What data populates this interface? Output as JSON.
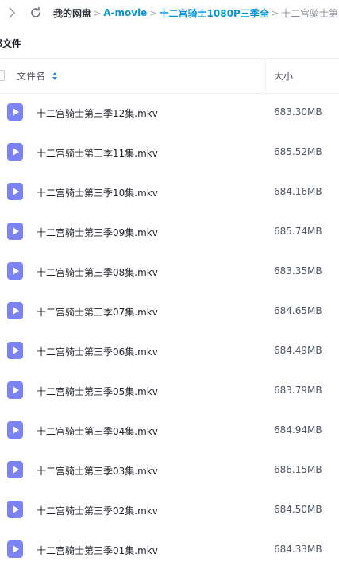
{
  "breadcrumb": {
    "root": "我的网盘",
    "items": [
      "A-movie",
      "十二宫骑士1080P三季全"
    ],
    "current": "十二宫骑士第三季"
  },
  "section_title": "部文件",
  "table": {
    "col_name": "文件名",
    "col_size": "大小"
  },
  "files": [
    {
      "name": "十二宫骑士第三季12集.mkv",
      "size": "683.30MB"
    },
    {
      "name": "十二宫骑士第三季11集.mkv",
      "size": "685.52MB"
    },
    {
      "name": "十二宫骑士第三季10集.mkv",
      "size": "684.16MB"
    },
    {
      "name": "十二宫骑士第三季09集.mkv",
      "size": "685.74MB"
    },
    {
      "name": "十二宫骑士第三季08集.mkv",
      "size": "683.35MB"
    },
    {
      "name": "十二宫骑士第三季07集.mkv",
      "size": "684.65MB"
    },
    {
      "name": "十二宫骑士第三季06集.mkv",
      "size": "684.49MB"
    },
    {
      "name": "十二宫骑士第三季05集.mkv",
      "size": "683.79MB"
    },
    {
      "name": "十二宫骑士第三季04集.mkv",
      "size": "684.94MB"
    },
    {
      "name": "十二宫骑士第三季03集.mkv",
      "size": "686.15MB"
    },
    {
      "name": "十二宫骑士第三季02集.mkv",
      "size": "684.50MB"
    },
    {
      "name": "十二宫骑士第三季01集.mkv",
      "size": "684.33MB"
    }
  ],
  "icons": {
    "back": "chevron-left-icon",
    "refresh": "refresh-icon",
    "sort": "sort-icon",
    "file": "video-file-icon"
  },
  "colors": {
    "link": "#0b93d4",
    "file_icon": "#7b83f4",
    "sort_active": "#2d8cf0"
  }
}
